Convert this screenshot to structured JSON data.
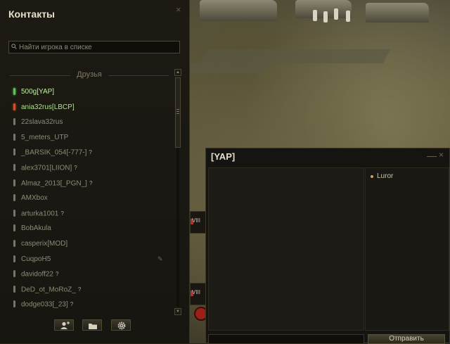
{
  "contacts": {
    "title": "Контакты",
    "close_glyph": "×",
    "search_placeholder": "Найти игрока в списке",
    "group_label": "Друзья",
    "friends": [
      {
        "name": "500g[YAP]",
        "status": "online",
        "badge": ""
      },
      {
        "name": "ania32rus[LBCP]",
        "status": "battle",
        "badge": ""
      },
      {
        "name": "22slava32rus",
        "status": "offline",
        "badge": ""
      },
      {
        "name": "5_meters_UTP",
        "status": "offline",
        "badge": ""
      },
      {
        "name": "_BARSIK_054[-777-]",
        "status": "offline",
        "badge": "?"
      },
      {
        "name": "alex3701[LIION]",
        "status": "offline",
        "badge": "?"
      },
      {
        "name": "Almaz_2013[_PGN_]",
        "status": "offline",
        "badge": "?"
      },
      {
        "name": "AMXbox",
        "status": "offline",
        "badge": ""
      },
      {
        "name": "arturka1001",
        "status": "offline",
        "badge": "?"
      },
      {
        "name": "BobAkula",
        "status": "offline",
        "badge": ""
      },
      {
        "name": "casperix[MOD]",
        "status": "offline",
        "badge": ""
      },
      {
        "name": "CuqpoH5",
        "status": "offline",
        "badge": "",
        "note": "✎"
      },
      {
        "name": "davidoff22",
        "status": "offline",
        "badge": "?"
      },
      {
        "name": "DeD_ot_MoRoZ_",
        "status": "offline",
        "badge": "?"
      },
      {
        "name": "dodge033[_23]",
        "status": "offline",
        "badge": "?"
      }
    ],
    "buttons": [
      {
        "icon": "add-contact-icon"
      },
      {
        "icon": "folder-icon"
      },
      {
        "icon": "gear-icon"
      }
    ]
  },
  "chat": {
    "title": "[YAP]",
    "minimize_glyph": "—",
    "close_glyph": "×",
    "members": [
      "Luror"
    ],
    "input_value": "",
    "send_label": "Отправить"
  },
  "colors": {
    "online": "#4fd04a",
    "battle": "#e04a1e",
    "offline": "#7a7567"
  }
}
